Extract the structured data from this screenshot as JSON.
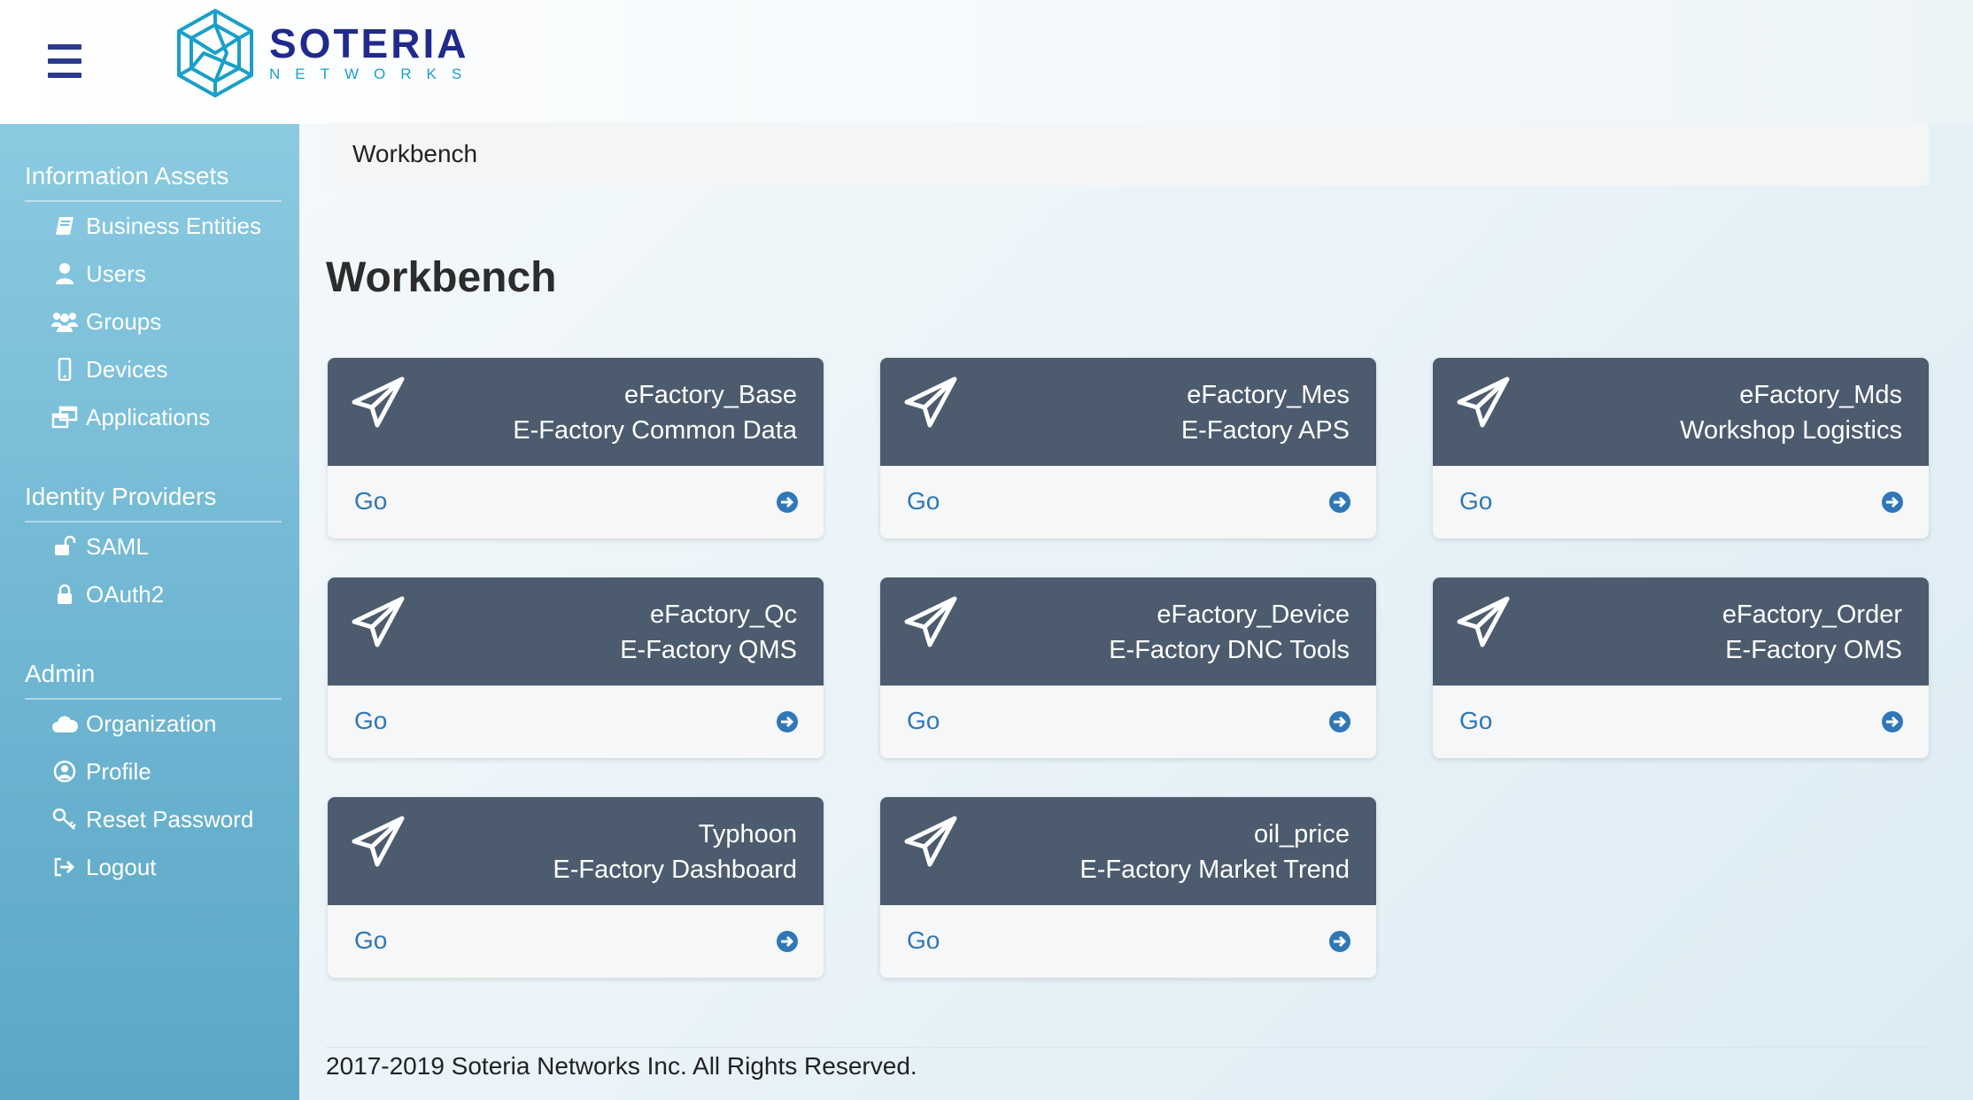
{
  "header": {
    "logo_name": "SOTERIA",
    "logo_sub": "NETWORKS"
  },
  "sidebar": {
    "sections": [
      {
        "heading": "Information Assets",
        "items": [
          {
            "label": "Business Entities",
            "icon": "book-icon"
          },
          {
            "label": "Users",
            "icon": "user-icon"
          },
          {
            "label": "Groups",
            "icon": "group-icon"
          },
          {
            "label": "Devices",
            "icon": "mobile-icon"
          },
          {
            "label": "Applications",
            "icon": "window-icon"
          }
        ]
      },
      {
        "heading": "Identity Providers",
        "items": [
          {
            "label": "SAML",
            "icon": "unlock-icon"
          },
          {
            "label": "OAuth2",
            "icon": "lock-icon"
          }
        ]
      },
      {
        "heading": "Admin",
        "items": [
          {
            "label": "Organization",
            "icon": "cloud-icon"
          },
          {
            "label": "Profile",
            "icon": "user-circle-icon"
          },
          {
            "label": "Reset Password",
            "icon": "key-icon"
          },
          {
            "label": "Logout",
            "icon": "logout-icon"
          }
        ]
      }
    ]
  },
  "breadcrumb": "Workbench",
  "page_title": "Workbench",
  "cards": [
    {
      "title": "eFactory_Base",
      "subtitle": "E-Factory Common Data",
      "action": "Go"
    },
    {
      "title": "eFactory_Mes",
      "subtitle": "E-Factory APS",
      "action": "Go"
    },
    {
      "title": "eFactory_Mds",
      "subtitle": "Workshop Logistics",
      "action": "Go"
    },
    {
      "title": "eFactory_Qc",
      "subtitle": "E-Factory QMS",
      "action": "Go"
    },
    {
      "title": "eFactory_Device",
      "subtitle": "E-Factory DNC Tools",
      "action": "Go"
    },
    {
      "title": "eFactory_Order",
      "subtitle": "E-Factory OMS",
      "action": "Go"
    },
    {
      "title": "Typhoon",
      "subtitle": "E-Factory Dashboard",
      "action": "Go"
    },
    {
      "title": "oil_price",
      "subtitle": "E-Factory Market Trend",
      "action": "Go"
    }
  ],
  "footer": "2017-2019 Soteria Networks Inc. All Rights Reserved.",
  "colors": {
    "card_header": "#4c5c6e",
    "link": "#2f77b8",
    "sidebar_top": "#8bcae1",
    "sidebar_bottom": "#5aa7c6",
    "brand_navy": "#1f2a8c",
    "brand_teal": "#1a9fc9"
  }
}
